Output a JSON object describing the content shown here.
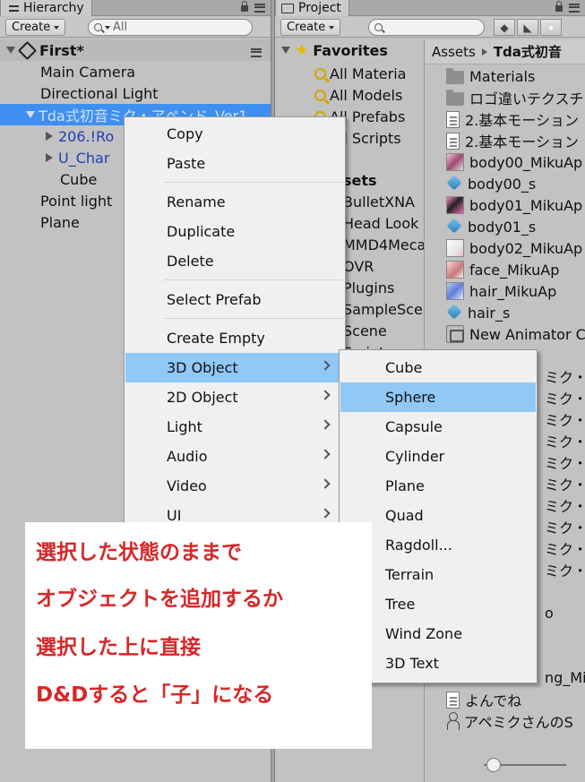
{
  "hierarchy": {
    "tab_title": "Hierarchy",
    "create_label": "Create",
    "search_value": "All",
    "scene_name": "First*",
    "rows": [
      {
        "label": "Main Camera"
      },
      {
        "label": "Directional Light"
      },
      {
        "label": "Tda式初音ミク・アペンド_Ver1"
      },
      {
        "label": "206.!Ro"
      },
      {
        "label": "U_Char"
      },
      {
        "label": "Cube"
      },
      {
        "label": "Point light"
      },
      {
        "label": "Plane"
      }
    ]
  },
  "project": {
    "tab_title": "Project",
    "create_label": "Create",
    "favorites": {
      "title": "Favorites",
      "items": [
        "All Materia",
        "All Models",
        "All Prefabs",
        "All Scripts"
      ]
    },
    "assets_partial": [
      {
        "label": "sets"
      },
      {
        "label": "BulletXNA"
      },
      {
        "label": "Head Look"
      },
      {
        "label": "MMD4Meca"
      },
      {
        "label": "OVR"
      },
      {
        "label": "Plugins"
      },
      {
        "label": "SampleSce"
      },
      {
        "label": "Scene"
      },
      {
        "label": "Script"
      }
    ],
    "breadcrumb": {
      "root": "Assets",
      "current": "Tda式初音"
    },
    "files": [
      {
        "label": "Materials",
        "icon": "folder-icon"
      },
      {
        "label": "ロゴ違いテクスチ",
        "icon": "folder-icon"
      },
      {
        "label": "2.基本モーション",
        "icon": "document-icon"
      },
      {
        "label": "2.基本モーション",
        "icon": "text-file-icon"
      },
      {
        "label": "body00_MikuAp",
        "icon": "texture-icon"
      },
      {
        "label": "body00_s",
        "icon": "material-icon"
      },
      {
        "label": "body01_MikuAp",
        "icon": "texture-icon"
      },
      {
        "label": "body01_s",
        "icon": "material-icon"
      },
      {
        "label": "body02_MikuAp",
        "icon": "texture-icon"
      },
      {
        "label": "face_MikuAp",
        "icon": "texture-icon"
      },
      {
        "label": "hair_MikuAp",
        "icon": "texture-icon"
      },
      {
        "label": "hair_s",
        "icon": "material-icon"
      },
      {
        "label": "New Animator C",
        "icon": "animator-icon"
      }
    ],
    "files_partial": [
      {
        "label": "ミク・"
      },
      {
        "label": "ミク・"
      },
      {
        "label": "ミク・"
      },
      {
        "label": "ミク・"
      },
      {
        "label": "ミク・"
      },
      {
        "label": "ミク・"
      },
      {
        "label": "ミク・"
      },
      {
        "label": "ミク・"
      },
      {
        "label": "ミク・"
      },
      {
        "label": "ミク・"
      },
      {
        "label": "o"
      },
      {
        "label": "ng_MikuAp"
      }
    ],
    "files_bottom": [
      {
        "label": "よんでね",
        "icon": "text-file-icon"
      },
      {
        "label": "アペミクさんのS",
        "icon": "person-icon"
      }
    ]
  },
  "context_menu": {
    "items": [
      {
        "label": "Copy"
      },
      {
        "label": "Paste"
      },
      {
        "label": "Rename"
      },
      {
        "label": "Duplicate"
      },
      {
        "label": "Delete"
      },
      {
        "label": "Select Prefab"
      },
      {
        "label": "Create Empty"
      },
      {
        "label": "3D Object",
        "has_submenu": true,
        "highlighted": true
      },
      {
        "label": "2D Object",
        "has_submenu": true
      },
      {
        "label": "Light",
        "has_submenu": true
      },
      {
        "label": "Audio",
        "has_submenu": true
      },
      {
        "label": "Video",
        "has_submenu": true
      },
      {
        "label": "UI",
        "has_submenu": true
      }
    ]
  },
  "submenu_3d": {
    "items": [
      {
        "label": "Cube"
      },
      {
        "label": "Sphere",
        "highlighted": true
      },
      {
        "label": "Capsule"
      },
      {
        "label": "Cylinder"
      },
      {
        "label": "Plane"
      },
      {
        "label": "Quad"
      },
      {
        "label": "Ragdoll..."
      },
      {
        "label": "Terrain"
      },
      {
        "label": "Tree"
      },
      {
        "label": "Wind Zone"
      },
      {
        "label": "3D Text"
      }
    ]
  },
  "annotation": {
    "lines": [
      "選択した状態のままで",
      "オブジェクトを追加するか",
      "選択した上に直接",
      "D&Dすると「子」になる"
    ],
    "color": "#d62727"
  },
  "colors": {
    "selection": "#3f8ff0",
    "menu_highlight": "#90c8f6",
    "panel_bg": "#c2c2c2"
  }
}
